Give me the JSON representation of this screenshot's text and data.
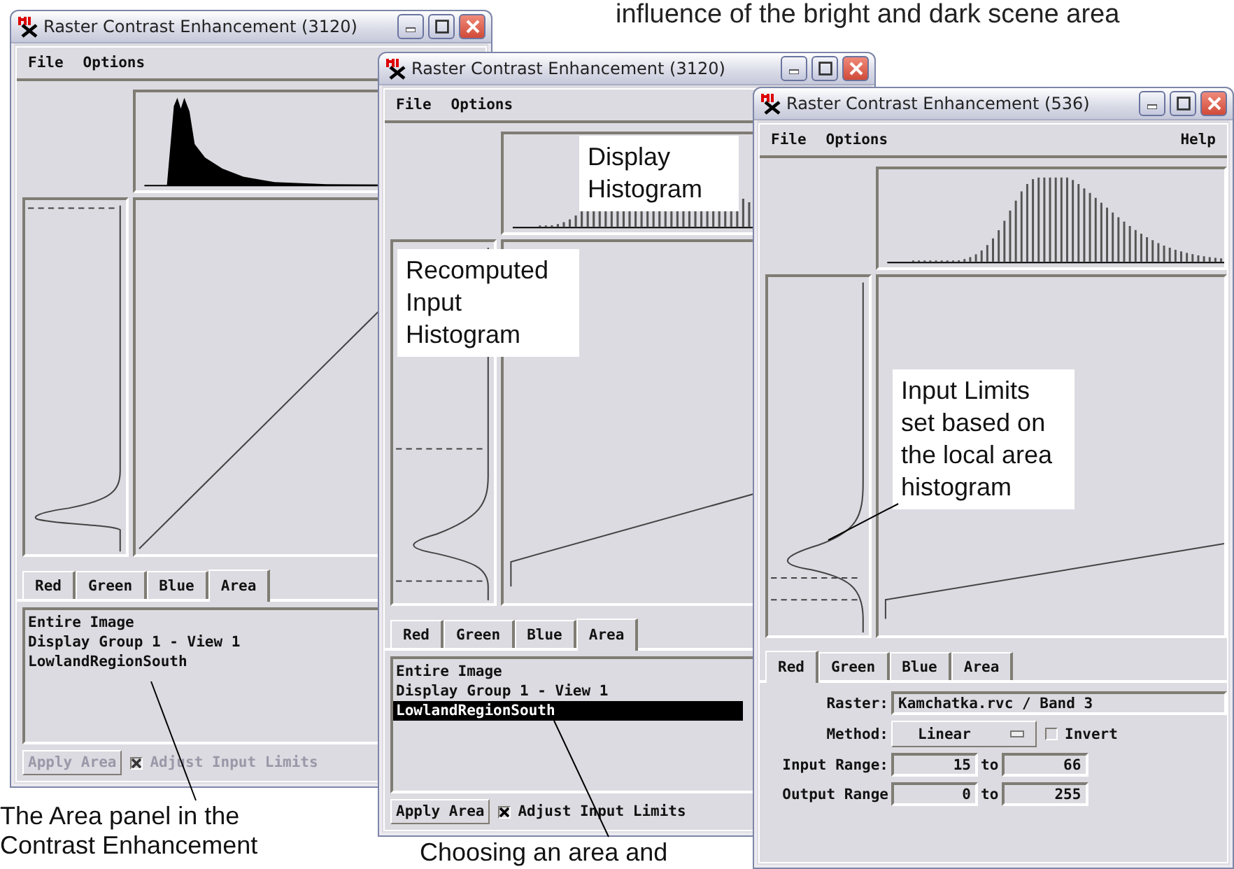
{
  "intro_text": "influence of the bright and dark scene area",
  "windows": [
    {
      "title": "Raster Contrast Enhancement (3120)",
      "menu": [
        "File",
        "Options"
      ],
      "tabs": [
        {
          "label": "Red",
          "selected": false
        },
        {
          "label": "Green",
          "selected": false
        },
        {
          "label": "Blue",
          "selected": false
        },
        {
          "label": "Area",
          "selected": true
        }
      ],
      "panel": {
        "kind": "area",
        "items": [
          {
            "label": "Entire Image",
            "selected": false
          },
          {
            "label": "Display Group 1 - View 1",
            "selected": false
          },
          {
            "label": "LowlandRegionSouth",
            "selected": false
          }
        ],
        "apply_button": {
          "label": "Apply Area",
          "disabled": true
        },
        "adjust_checkbox": {
          "label": "Adjust Input Limits",
          "checked": true,
          "disabled": true
        }
      }
    },
    {
      "title": "Raster Contrast Enhancement (3120)",
      "menu": [
        "File",
        "Options"
      ],
      "tabs": [
        {
          "label": "Red",
          "selected": false
        },
        {
          "label": "Green",
          "selected": false
        },
        {
          "label": "Blue",
          "selected": false
        },
        {
          "label": "Area",
          "selected": true
        }
      ],
      "panel": {
        "kind": "area",
        "items": [
          {
            "label": "Entire Image",
            "selected": false
          },
          {
            "label": "Display Group 1 - View 1",
            "selected": false
          },
          {
            "label": "LowlandRegionSouth",
            "selected": true
          }
        ],
        "apply_button": {
          "label": "Apply Area",
          "disabled": false
        },
        "adjust_checkbox": {
          "label": "Adjust Input Limits",
          "checked": true,
          "disabled": false
        }
      }
    },
    {
      "title": "Raster Contrast Enhancement (536)",
      "menu": [
        "File",
        "Options",
        "Help"
      ],
      "tabs": [
        {
          "label": "Red",
          "selected": true
        },
        {
          "label": "Green",
          "selected": false
        },
        {
          "label": "Blue",
          "selected": false
        },
        {
          "label": "Area",
          "selected": false
        }
      ],
      "panel": {
        "kind": "settings",
        "raster_label": "Raster:",
        "raster_value": "Kamchatka.rvc / Band 3",
        "method_label": "Method:",
        "method_value": "Linear",
        "invert": {
          "label": "Invert",
          "checked": false
        },
        "ranges": [
          {
            "label": "Input Range:",
            "from": "15",
            "to_label": "to",
            "to": "66"
          },
          {
            "label": "Output Range",
            "from": "0",
            "to_label": "to",
            "to": "255"
          }
        ]
      }
    }
  ],
  "callouts": [
    "Display Histogram",
    "Recomputed Input Histogram",
    "Input Limits set based on the local area histogram"
  ],
  "captions": [
    "The Area panel in the Contrast Enhancement",
    "Choosing an area and"
  ]
}
